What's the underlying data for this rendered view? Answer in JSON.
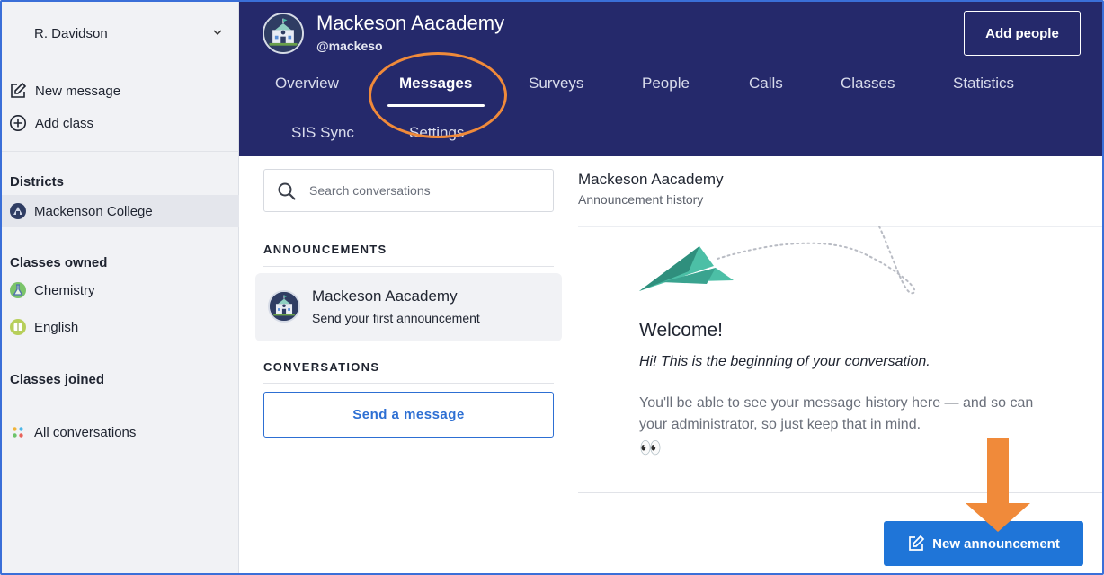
{
  "sidebar": {
    "user_name": "R. Davidson",
    "actions": [
      {
        "label": "New message",
        "icon": "edit-icon"
      },
      {
        "label": "Add class",
        "icon": "plus-circle-icon"
      }
    ],
    "districts": {
      "heading": "Districts",
      "items": [
        {
          "label": "Mackenson College",
          "icon": "district-icon"
        }
      ]
    },
    "classes_owned": {
      "heading": "Classes owned",
      "items": [
        {
          "label": "Chemistry",
          "icon": "flask-icon"
        },
        {
          "label": "English",
          "icon": "book-icon"
        }
      ]
    },
    "classes_joined": {
      "heading": "Classes joined",
      "items": [
        {
          "label": "All conversations",
          "icon": "dots-icon"
        }
      ]
    }
  },
  "header": {
    "school_name": "Mackeson Aacademy",
    "handle": "@mackeso",
    "add_people_label": "Add people",
    "tabs": [
      "Overview",
      "Messages",
      "Surveys",
      "People",
      "Calls",
      "Classes",
      "Statistics",
      "SIS Sync",
      "Settings"
    ],
    "active_tab": "Messages"
  },
  "conversations": {
    "search_placeholder": "Search conversations",
    "announcements_heading": "ANNOUNCEMENTS",
    "announcement_card": {
      "title": "Mackeson Aacademy",
      "subtitle": "Send your first announcement"
    },
    "conversations_heading": "CONVERSATIONS",
    "send_message_label": "Send a message"
  },
  "panel": {
    "title": "Mackeson Aacademy",
    "subtitle": "Announcement history",
    "welcome": "Welcome!",
    "hi_text": "Hi! This is the beginning of your conversation.",
    "info_text": "You'll be able to see your message history here — and so can your administrator, so just keep that in mind.",
    "eyes": "👀",
    "new_announcement_label": "New announcement"
  },
  "colors": {
    "header_bg": "#25296b",
    "accent_blue": "#1f75d8",
    "annotation_orange": "#f08a3a",
    "plane_teal": "#4cbfa6"
  }
}
